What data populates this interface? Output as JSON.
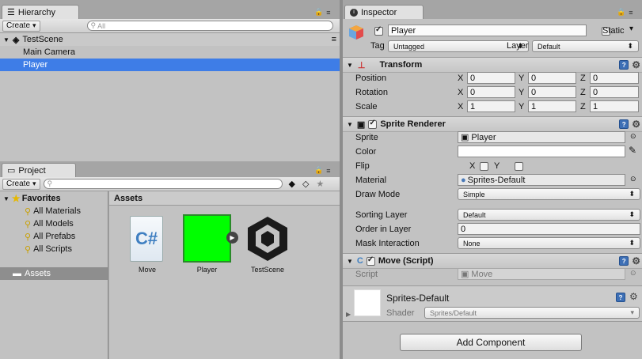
{
  "hierarchy": {
    "tab_label": "Hierarchy",
    "create_label": "Create",
    "search_placeholder": "All",
    "scene_name": "TestScene",
    "items": [
      {
        "label": "Main Camera"
      },
      {
        "label": "Player"
      }
    ]
  },
  "project": {
    "tab_label": "Project",
    "create_label": "Create",
    "favorites_label": "Favorites",
    "favorites": [
      {
        "label": "All Materials"
      },
      {
        "label": "All Models"
      },
      {
        "label": "All Prefabs"
      },
      {
        "label": "All Scripts"
      }
    ],
    "assets_tree_label": "Assets",
    "assets_header": "Assets",
    "assets": [
      {
        "label": "Move",
        "icon": "csharp-script-icon"
      },
      {
        "label": "Player",
        "icon": "green-sprite-thumbnail",
        "color": "#00ff00"
      },
      {
        "label": "TestScene",
        "icon": "unity-scene-icon"
      }
    ]
  },
  "inspector": {
    "tab_label": "Inspector",
    "object_name": "Player",
    "static_label": "Static",
    "tag_label": "Tag",
    "tag_value": "Untagged",
    "layer_label": "Layer",
    "layer_value": "Default",
    "transform": {
      "title": "Transform",
      "position": {
        "label": "Position",
        "x": "0",
        "y": "0",
        "z": "0"
      },
      "rotation": {
        "label": "Rotation",
        "x": "0",
        "y": "0",
        "z": "0"
      },
      "scale": {
        "label": "Scale",
        "x": "1",
        "y": "1",
        "z": "1"
      }
    },
    "axis": {
      "x": "X",
      "y": "Y",
      "z": "Z"
    },
    "sprite_renderer": {
      "title": "Sprite Renderer",
      "sprite_label": "Sprite",
      "sprite_value": "Player",
      "color_label": "Color",
      "color_value": "#ffffff",
      "flip_label": "Flip",
      "flip_x": "X",
      "flip_y": "Y",
      "material_label": "Material",
      "material_value": "Sprites-Default",
      "draw_mode_label": "Draw Mode",
      "draw_mode_value": "Simple",
      "sorting_layer_label": "Sorting Layer",
      "sorting_layer_value": "Default",
      "order_label": "Order in Layer",
      "order_value": "0",
      "mask_label": "Mask Interaction",
      "mask_value": "None"
    },
    "move_script": {
      "title": "Move (Script)",
      "script_label": "Script",
      "script_value": "Move"
    },
    "material": {
      "name": "Sprites-Default",
      "shader_label": "Shader",
      "shader_value": "Sprites/Default"
    },
    "add_component_label": "Add Component"
  },
  "colors": {
    "selection": "#3e7de7",
    "help": "#3d6fb5",
    "sprite_green": "#00ff00"
  }
}
